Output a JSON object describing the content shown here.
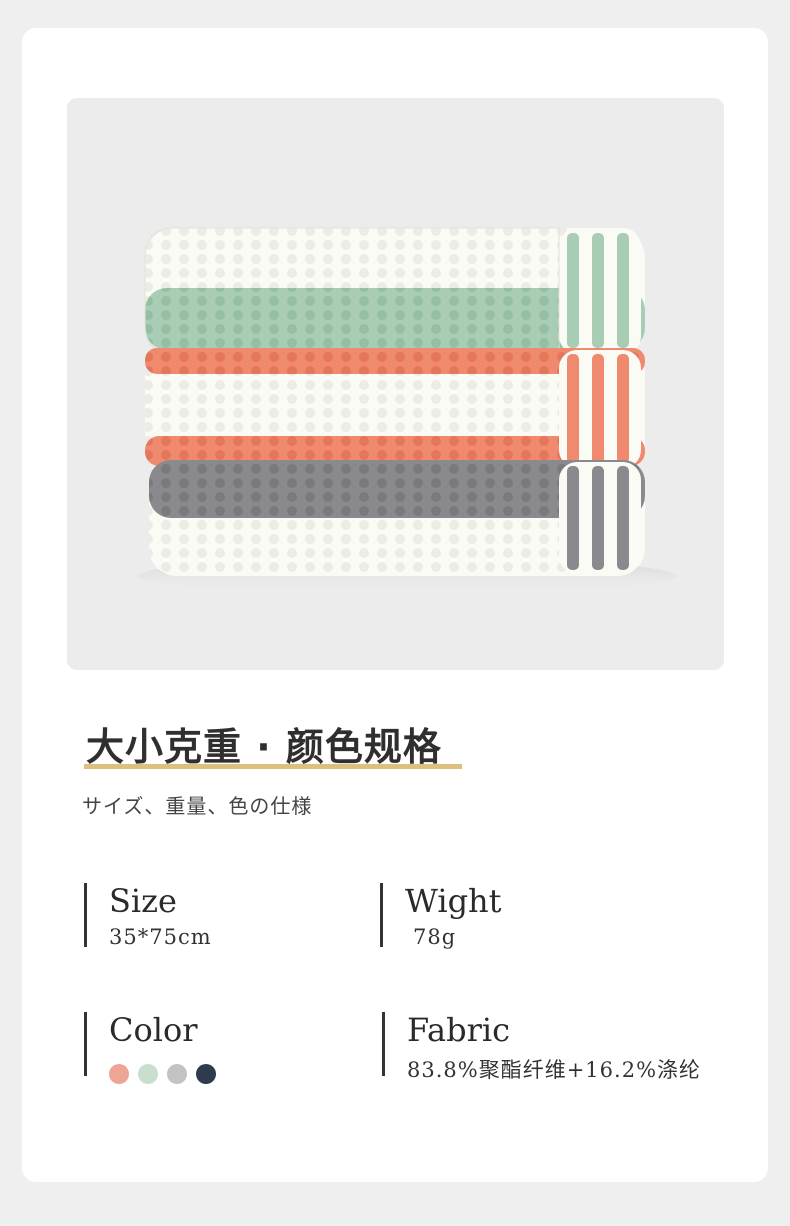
{
  "section": {
    "heading": "大小克重 · 颜色规格",
    "subheading": "サイズ、重量、色の仕様"
  },
  "specs": {
    "size": {
      "title": "Size",
      "value": "35*75cm"
    },
    "weight": {
      "title": "Wight",
      "value": "78g"
    },
    "color": {
      "title": "Color",
      "swatches": [
        "#eea596",
        "#c8dfce",
        "#c3c3c6",
        "#2e3a4e"
      ]
    },
    "fabric": {
      "title": "Fabric",
      "value": "83.8%聚酯纤维+16.2%涤纶"
    }
  },
  "photo": {
    "towels": [
      {
        "accent": "#a9cdb4",
        "base": "#fbfbf6"
      },
      {
        "accent": "#f08a6e",
        "base": "#fbfbf6"
      },
      {
        "accent": "#8a898e",
        "base": "#fbfbf6"
      }
    ]
  }
}
